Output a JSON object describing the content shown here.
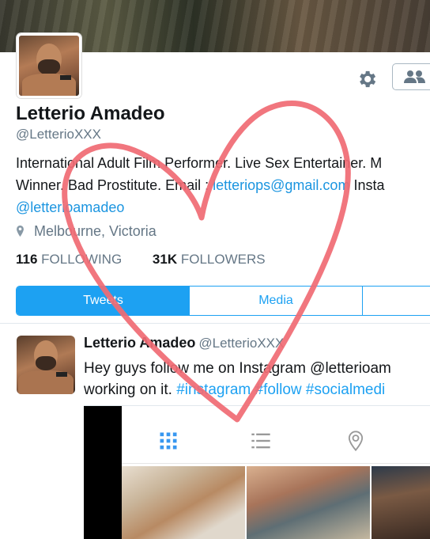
{
  "profile": {
    "name": "Letterio Amadeo",
    "handle": "@LetterioXXX",
    "bio_line1": "International Adult Film Performer. Live Sex Entertainer. M",
    "bio_line2_prefix": "Winner. Bad Prostitute. Email : ",
    "bio_email": "letteriops@gmail.com",
    "bio_line2_suffix": " Insta",
    "bio_line3": "@letterioamadeo",
    "location": "Melbourne, Victoria",
    "following_count": "116",
    "following_label": "FOLLOWING",
    "followers_count": "31K",
    "followers_label": "FOLLOWERS"
  },
  "tabs": [
    {
      "label": "Tweets"
    },
    {
      "label": "Media"
    },
    {
      "label": ""
    }
  ],
  "tweet": {
    "name": "Letterio Amadeo",
    "handle": "@LetterioXXX",
    "line1": "Hey guys follow me on Instagram @letterioam",
    "line2_prefix": "working on it. ",
    "hashtags": "#instagram #follow #socialmedi"
  },
  "icons": {
    "settings": "gear-icon",
    "follow": "people-icon",
    "location": "map-pin-icon",
    "grid": "grid-icon",
    "list": "list-icon",
    "place": "location-pin-icon"
  },
  "colors": {
    "accent": "#1da1f2",
    "heart": "#f06a73"
  }
}
